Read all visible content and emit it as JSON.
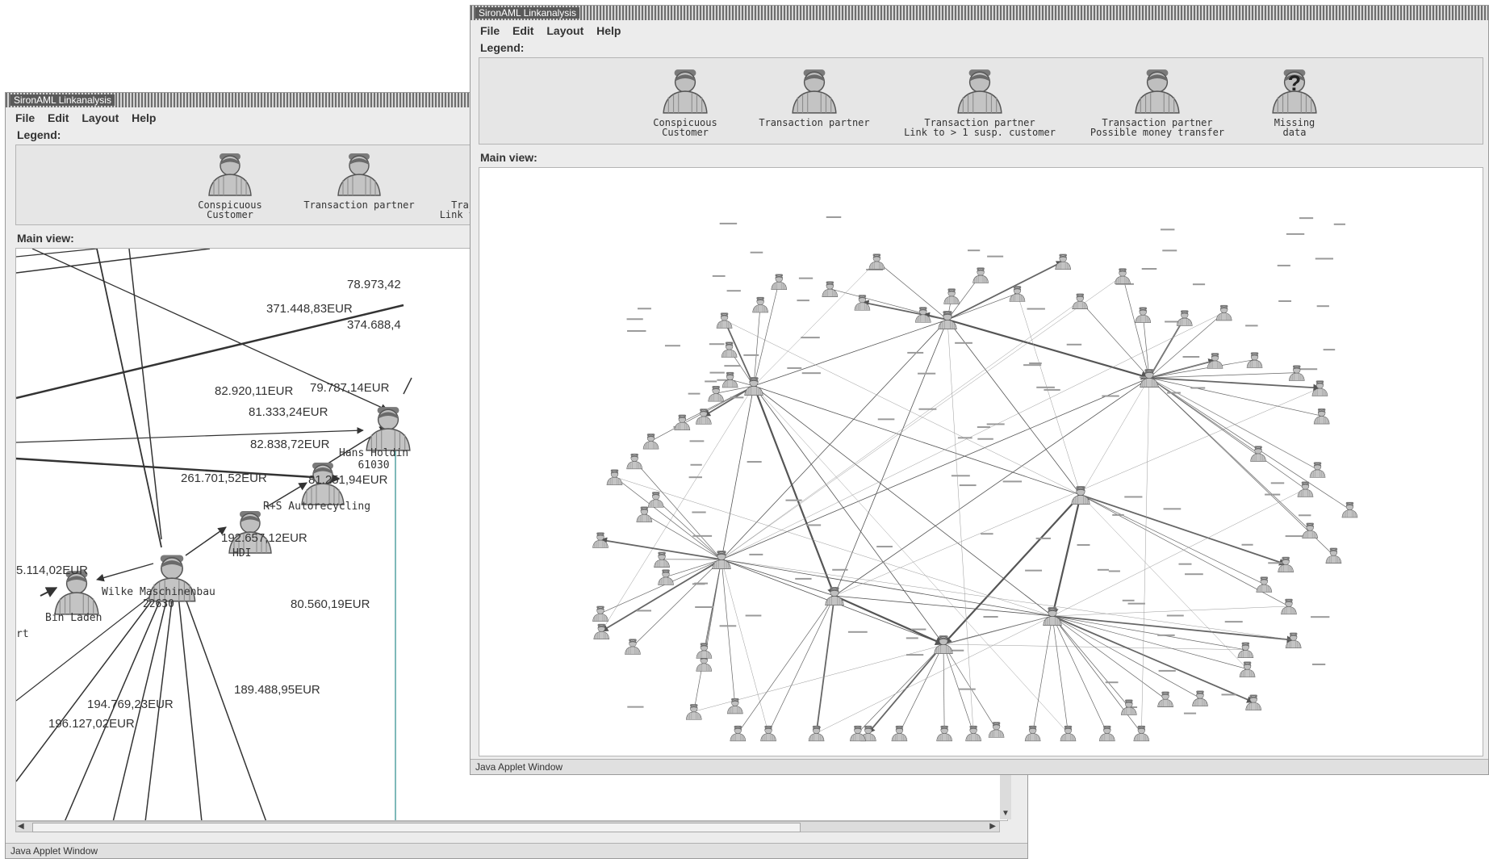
{
  "app_title": "SironAML Linkanalysis",
  "menu": [
    "File",
    "Edit",
    "Layout",
    "Help"
  ],
  "legend_label": "Legend:",
  "main_view_label": "Main view:",
  "status_text": "Java Applet Window",
  "legend_items": [
    {
      "icon": "conspicuous-customer-icon",
      "line1": "Conspicuous",
      "line2": "Customer"
    },
    {
      "icon": "transaction-partner-icon",
      "line1": "Transaction partner",
      "line2": ""
    },
    {
      "icon": "transaction-partner-multi-link-icon",
      "line1": "Transaction partner",
      "line2": "Link to > 1 susp. customer"
    },
    {
      "icon": "possible-money-transfer-icon",
      "line1": "Transaction partner",
      "line2": "Possible money transfer"
    },
    {
      "icon": "missing-data-icon",
      "line1": "Missing",
      "line2": "data"
    }
  ],
  "back_window": {
    "legend_truncated": {
      "line1": "Tra",
      "line2": "Link to"
    },
    "amounts": [
      "78.973,42",
      "371.448,83EUR",
      "374.688,4",
      "82.920,11EUR",
      "79.787,14EUR",
      "81.333,24EUR",
      "82.838,72EUR",
      "261.701,52EUR",
      "81.251,94EUR",
      "192.657,12EUR",
      "5.114,02EUR",
      "80.560,19EUR",
      "194.769,23EUR",
      "189.488,95EUR",
      "196.127,02EUR"
    ],
    "nodes": {
      "hans": "Hans Holdin",
      "hans_zip": "61030",
      "rs": "R+S Autorecycling",
      "hdi": "HDI",
      "wilke": "Wilke Maschinenbau",
      "wilke_zip": "22630",
      "binladen": "Bin Laden",
      "cut": "rt"
    }
  },
  "colors": {
    "window_bg": "#ececec",
    "panel_bg": "#e6e6e6",
    "canvas_bg": "#ffffff",
    "edge": "#333333"
  }
}
